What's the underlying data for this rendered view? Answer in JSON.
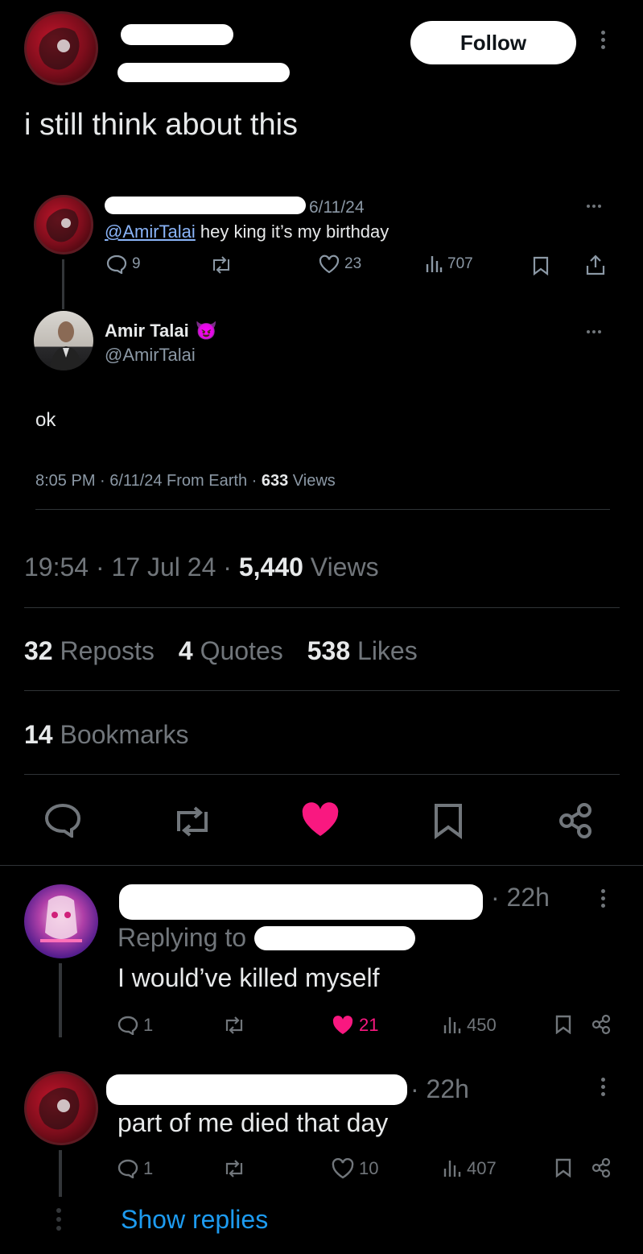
{
  "main_tweet": {
    "text": "i still think about this",
    "follow_label": "Follow"
  },
  "quoted_thread": {
    "reply": {
      "date": "6/11/24",
      "mention": "@AmirTalai",
      "text": " hey king it’s my birthday",
      "replies": "9",
      "likes": "23",
      "views": "707"
    },
    "author": {
      "name": "Amir Talai",
      "badge_emoji": "😈",
      "handle": "@AmirTalai",
      "text": "ok",
      "meta_prefix": "8:05 PM · 6/11/24 From Earth · ",
      "views_count": "633",
      "views_label": " Views"
    }
  },
  "main_meta": {
    "time_date": "19:54 · 17 Jul 24 · ",
    "views_count": "5,440",
    "views_label": " Views"
  },
  "engagement": {
    "reposts_count": "32",
    "reposts_label": " Reposts",
    "quotes_count": "4",
    "quotes_label": " Quotes",
    "likes_count": "538",
    "likes_label": " Likes",
    "bookmarks_count": "14",
    "bookmarks_label": " Bookmarks"
  },
  "colors": {
    "like_active": "#f91880",
    "link": "#1d9bf0",
    "muted": "#71767b"
  },
  "replies": [
    {
      "time": "· 22h",
      "replying_to": "Replying to",
      "text": "I would’ve killed myself",
      "replies": "1",
      "likes": "21",
      "liked": true,
      "views": "450"
    },
    {
      "time": "· 22h",
      "text": "part of me died that day",
      "replies": "1",
      "likes": "10",
      "liked": false,
      "views": "407",
      "show_replies": "Show replies"
    }
  ]
}
